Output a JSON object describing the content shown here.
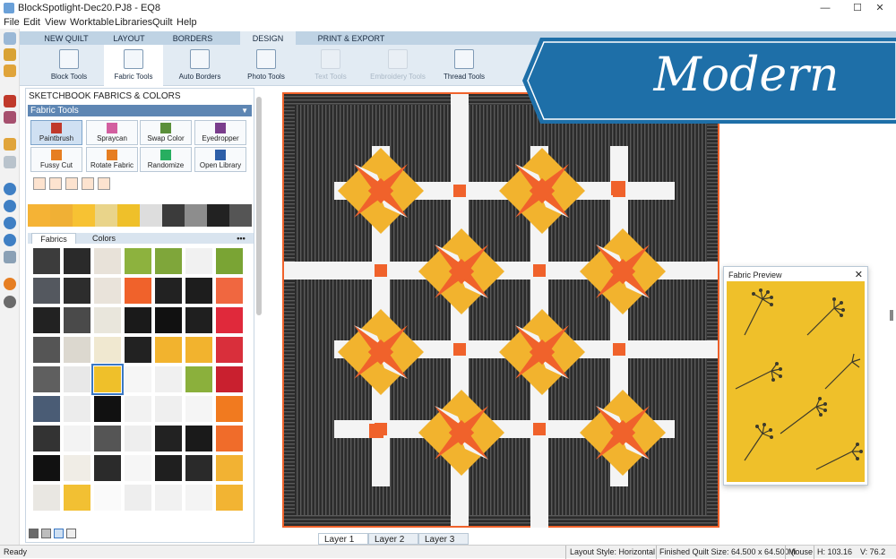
{
  "window": {
    "title": "BlockSpotlight-Dec20.PJ8 - EQ8",
    "controls": [
      "—",
      "☐",
      "✕"
    ]
  },
  "menu": [
    "File",
    "Edit",
    "View",
    "Worktable",
    "Libraries",
    "Quilt",
    "Help"
  ],
  "tabs": [
    {
      "label": "NEW QUILT"
    },
    {
      "label": "LAYOUT"
    },
    {
      "label": "BORDERS"
    },
    {
      "label": "DESIGN",
      "active": true
    },
    {
      "label": "PRINT & EXPORT"
    }
  ],
  "ribbon": [
    {
      "label": "Block Tools"
    },
    {
      "label": "Fabric Tools",
      "active": true
    },
    {
      "label": "Auto Borders"
    },
    {
      "label": "Photo Tools"
    },
    {
      "label": "Text Tools",
      "disabled": true
    },
    {
      "label": "Embroidery Tools",
      "disabled": true
    },
    {
      "label": "Thread Tools"
    }
  ],
  "panel": {
    "header": "SKETCHBOOK FABRICS & COLORS",
    "section": "Fabric Tools",
    "buttons": [
      {
        "label": "Paintbrush",
        "color": "#c0392b"
      },
      {
        "label": "Spraycan",
        "color": "#d35fa0"
      },
      {
        "label": "Swap Color",
        "color": "#5a8f3a"
      },
      {
        "label": "Eyedropper",
        "color": "#7a3d8c"
      },
      {
        "label": "Fussy Cut",
        "color": "#e67e22"
      },
      {
        "label": "Rotate Fabric",
        "color": "#e67e22"
      },
      {
        "label": "Randomize",
        "color": "#27ae60"
      },
      {
        "label": "Open Library",
        "color": "#2e5fa8"
      }
    ],
    "subtabs": [
      "Fabrics",
      "Colors"
    ],
    "more": "•••"
  },
  "colors": {
    "orange": "#f0622b",
    "yellow": "#f2b32e",
    "white": "#f4f4f4",
    "dark": "#2b2b2b",
    "gray": "#4a4a4a",
    "accent": "#3a78c4",
    "banner": "#1e6fa8"
  },
  "recent_swatches": [
    "#f5b335",
    "#f0b035",
    "#f7c233",
    "#e9d48a",
    "#efc02a",
    "#ddd",
    "#3b3b3b",
    "#8d8d8d",
    "#222",
    "#555"
  ],
  "swatches": [
    "#3c3c3c",
    "#2a2a2a",
    "#e8e2d9",
    "#8db23e",
    "#7fa63a",
    "#f1f1f1",
    "#7aa434",
    "#54585f",
    "#2d2d2d",
    "#e9e3da",
    "#f0622b",
    "#222",
    "#1d1d1d",
    "#f06740",
    "#222",
    "#4a4a4a",
    "#e9e6dc",
    "#1a1a1a",
    "#111",
    "#1f1f1f",
    "#e0293b",
    "#555",
    "#dcd8cf",
    "#f0e8d0",
    "#222",
    "#f2b32e",
    "#f2b32e",
    "#d92f3b",
    "#5f5f5f",
    "#e8e8e8",
    "#efc02a",
    "#f6f6f6",
    "#f0f0f0",
    "#8bb03c",
    "#c9202f",
    "#4a5c75",
    "#ececec",
    "#111",
    "#f2f2f2",
    "#efefef",
    "#f5f5f5",
    "#f17a1f",
    "#333",
    "#f3f3f3",
    "#555",
    "#eeeeee",
    "#222",
    "#1a1a1a",
    "#f06c2a",
    "#111",
    "#f0ede6",
    "#2b2b2b",
    "#f6f6f6",
    "#1f1f1f",
    "#2a2a2a",
    "#f2b233",
    "#e9e7e2",
    "#f2c033",
    "#fafafa",
    "#eeeeee",
    "#f1f1f1",
    "#f4f4f4",
    "#f2b433"
  ],
  "swatch_selected": 30,
  "layers": [
    "Layer 1",
    "Layer 2",
    "Layer 3"
  ],
  "preview": {
    "title": "Fabric Preview",
    "close": "✕"
  },
  "banner": {
    "text": "Modern"
  },
  "status": {
    "ready": "Ready",
    "layout": "Layout Style: Horizontal",
    "size": "Finished Quilt Size: 64.500 x 64.500 (i",
    "mouse": "Mouse",
    "h": "H: 103.16",
    "v": "V: 76.2"
  }
}
